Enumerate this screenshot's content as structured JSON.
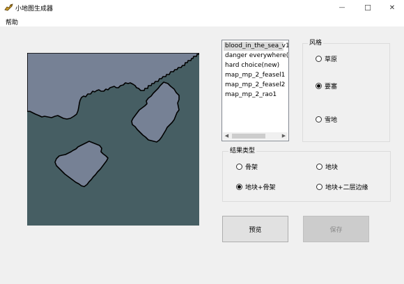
{
  "window": {
    "title": "小地图生成器",
    "app_icon": "dragon-icon",
    "minimize_glyph": "—",
    "maximize_glyph": "☐",
    "close_glyph": "✕"
  },
  "menu": {
    "help": "帮助"
  },
  "map_list": {
    "items": [
      "blood_in_the_sea_v1",
      "danger everywhere(new)",
      "hard choice(new)",
      "map_mp_2_feasel1",
      "map_mp_2_feasel2",
      "map_mp_2_rao1"
    ],
    "selected_index": 0
  },
  "style_group": {
    "label": "风格",
    "options": [
      "草原",
      "要塞",
      "雪地"
    ],
    "selected": "要塞"
  },
  "result_group": {
    "label": "结果类型",
    "options": [
      "骨架",
      "地块",
      "地块+骨架",
      "地块+二层边缘"
    ],
    "selected": "地块+骨架"
  },
  "buttons": {
    "preview": "预览",
    "save": "保存"
  },
  "colors": {
    "map_background": "#465e63",
    "map_land": "#768195",
    "map_outline": "#000000"
  }
}
